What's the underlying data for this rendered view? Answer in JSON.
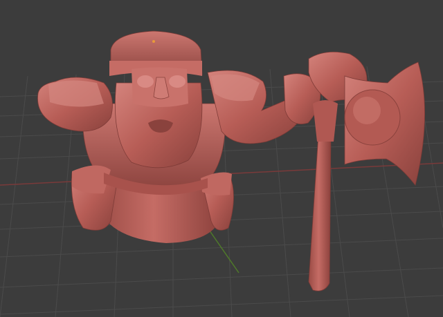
{
  "app": {
    "view": "3d-viewport-perspective",
    "shading": "solid-clay",
    "background_color": "#3d3d3d",
    "grid_color": "#4a4a4a",
    "x_axis_color": "#7a3a3a",
    "y_axis_color": "#4f7a2a",
    "origin_marker_color": "#e89a3a"
  },
  "model": {
    "subject": "dwarf-warrior-with-axe",
    "material_color": "#b85d56",
    "material_shadow_color": "#8e433f",
    "material_highlight_color": "#d98a84",
    "parts": [
      "helmet",
      "face",
      "beard",
      "left-arm",
      "right-arm",
      "body-armor",
      "base",
      "axe-handle",
      "axe-head"
    ]
  }
}
